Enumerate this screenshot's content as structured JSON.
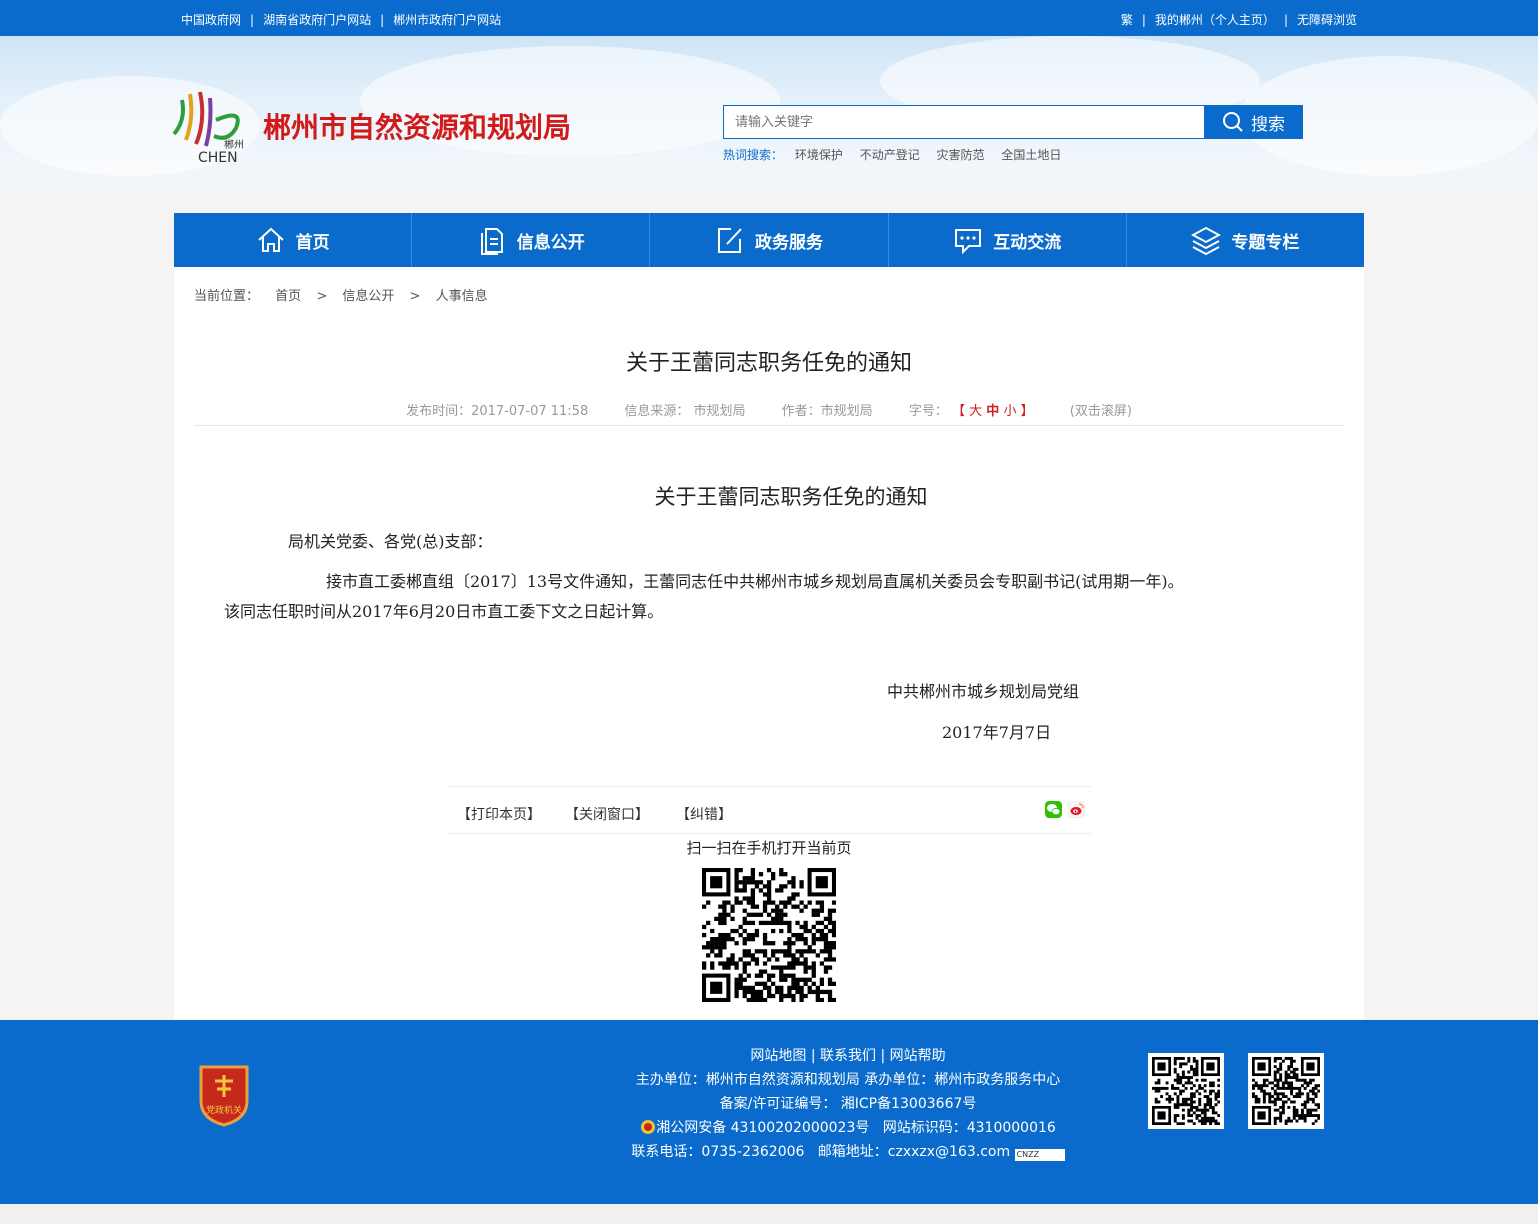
{
  "topbar": {
    "links": [
      "中国政府网",
      "湖南省政府门户网站",
      "郴州市政府门户网站"
    ],
    "right": [
      "繁",
      "我的郴州（个人主页）",
      "无障碍浏览"
    ]
  },
  "header": {
    "site_title": "郴州市自然资源和规划局",
    "logo_text_cn": "郴州",
    "logo_text_en": "CHEN",
    "search_placeholder": "请输入关键字",
    "search_button": "搜索",
    "hot_label": "热词搜索：",
    "hot_keywords": [
      "环境保护",
      "不动产登记",
      "灾害防范",
      "全国土地日"
    ]
  },
  "nav": [
    "首页",
    "信息公开",
    "政务服务",
    "互动交流",
    "专题专栏"
  ],
  "breadcrumb": {
    "label": "当前位置：",
    "items": [
      "首页",
      "信息公开",
      "人事信息"
    ],
    "gt": ">"
  },
  "article": {
    "title": "关于王蕾同志职务任免的通知",
    "publish_time": "发布时间：2017-07-07 11:58",
    "source": "信息来源： 市规划局",
    "author": "作者：市规划局",
    "font_label": "字号：",
    "font_open": "【",
    "font_large": "大",
    "font_medium": "中",
    "font_small": "小",
    "font_close": "】",
    "scroll": "(双击滚屏)",
    "body_title": "关于王蕾同志职务任免的通知",
    "salutation": "局机关党委、各党(总)支部：",
    "para1_line1": "接市直工委郴直组〔2017〕13号文件通知，王蕾同志任中共郴州市城乡规划局直属机关委员会专职副书记(试用期一年)。",
    "para1_line2": "该同志任职时间从2017年6月20日市直工委下文之日起计算。",
    "signature": "中共郴州市城乡规划局党组",
    "date": "2017年7月7日"
  },
  "tools": {
    "print": "【打印本页】",
    "close": "【关闭窗口】",
    "correct": "【纠错】",
    "scan_text": "扫一扫在手机打开当前页"
  },
  "footer": {
    "badge_text": "党政机关",
    "links": [
      "网站地图",
      "联系我们",
      "网站帮助"
    ],
    "sponsor": "主办单位：郴州市自然资源和规划局 承办单位：郴州市政务服务中心",
    "icp": "备案/许可证编号： 湘ICP备13003667号",
    "police": "湘公网安备 43100202000023号",
    "site_code": "网站标识码：4310000016",
    "phone": "联系电话：0735-2362006",
    "email": "邮箱地址：czxxzx@163.com",
    "cnzz": "CNZZ"
  },
  "colors": {
    "primary": "#0a6bcc",
    "title_red": "#d01b1b"
  },
  "icons": {
    "nav": [
      "home-icon",
      "document-icon",
      "edit-icon",
      "chat-icon",
      "layers-icon"
    ],
    "share": [
      "wechat-icon",
      "weibo-icon"
    ]
  }
}
